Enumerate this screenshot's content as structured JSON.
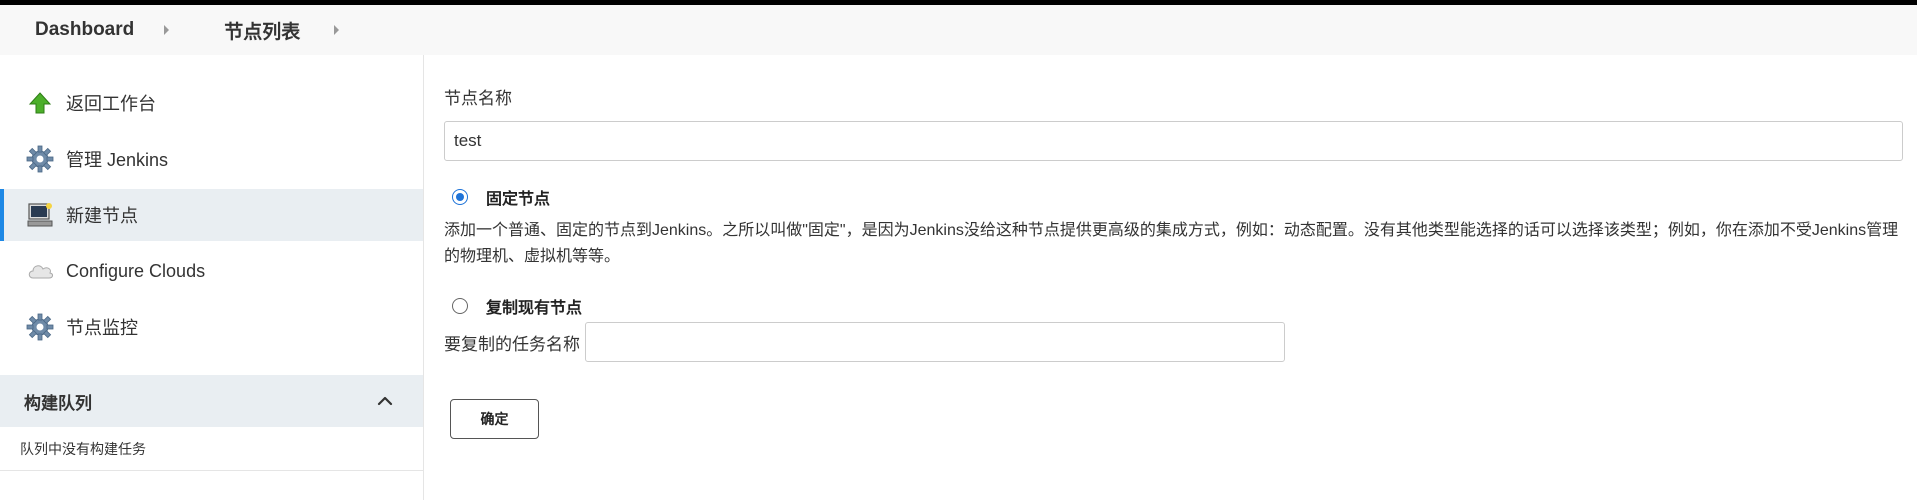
{
  "breadcrumbs": [
    {
      "label": "Dashboard"
    },
    {
      "label": "节点列表"
    }
  ],
  "sidebar": {
    "tasks": [
      {
        "label": "返回工作台",
        "icon": "up-arrow-icon",
        "active": false
      },
      {
        "label": "管理 Jenkins",
        "icon": "gear-icon",
        "active": false
      },
      {
        "label": "新建节点",
        "icon": "computer-icon",
        "active": true
      },
      {
        "label": "Configure Clouds",
        "icon": "cloud-icon",
        "active": false
      },
      {
        "label": "节点监控",
        "icon": "gear-icon",
        "active": false
      }
    ],
    "queue": {
      "title": "构建队列",
      "empty_text": "队列中没有构建任务"
    }
  },
  "form": {
    "node_name_label": "节点名称",
    "node_name_value": "test",
    "permanent_label": "固定节点",
    "permanent_checked": true,
    "permanent_desc": "添加一个普通、固定的节点到Jenkins。之所以叫做\"固定\"，是因为Jenkins没给这种节点提供更高级的集成方式，例如：动态配置。没有其他类型能选择的话可以选择该类型；例如，你在添加不受Jenkins管理的物理机、虚拟机等等。",
    "copy_label": "复制现有节点",
    "copy_checked": false,
    "copy_from_label": "要复制的任务名称",
    "copy_from_value": "",
    "ok_label": "确定"
  },
  "colors": {
    "accent": "#1e88e5",
    "active_bg": "#e9eef2"
  }
}
